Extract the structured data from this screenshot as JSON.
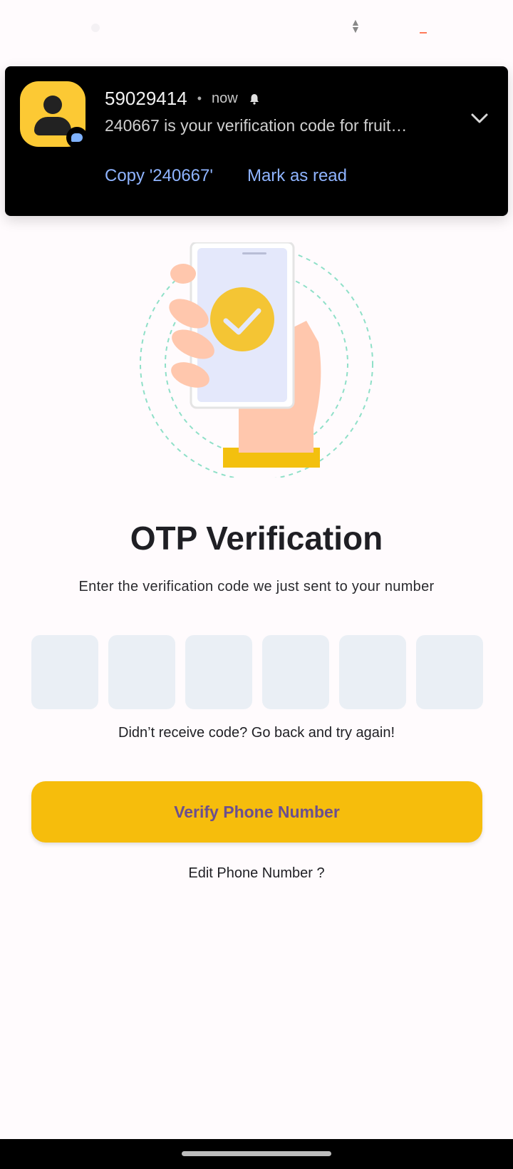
{
  "notification": {
    "sender": "59029414",
    "separator": "•",
    "time": "now",
    "message": "240667 is your verification code for fruit…",
    "actions": [
      "Copy '240667'",
      "Mark as read"
    ]
  },
  "screen": {
    "title": "OTP Verification",
    "subtitle": "Enter the verification code we just sent to your number",
    "otp_digits": [
      "",
      "",
      "",
      "",
      "",
      ""
    ],
    "resend_text": "Didn’t receive code? Go back and try again!",
    "verify_label": "Verify Phone Number",
    "edit_label": "Edit Phone Number ?"
  },
  "colors": {
    "accent": "#f6bd0c",
    "button_text": "#6b4f8f",
    "otp_box": "#eaeff5",
    "notification_bg": "#000000",
    "notification_link": "#8fb4ff"
  },
  "icons": {
    "avatar": "person-icon",
    "badge": "message-icon",
    "alert": "bell-icon",
    "expand": "chevron-down-icon",
    "illustration": "phone-check-icon"
  }
}
